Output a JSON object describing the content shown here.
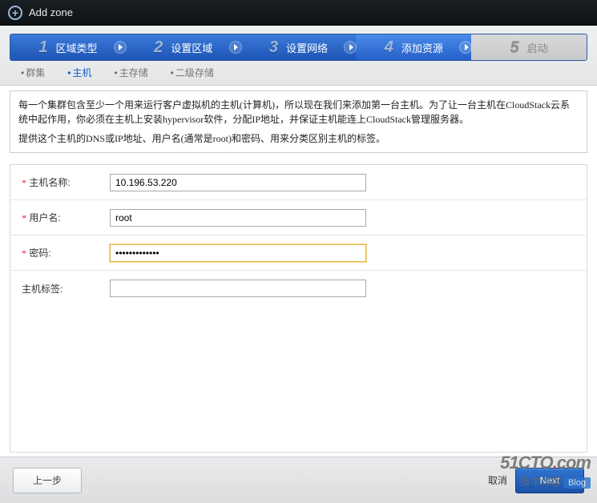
{
  "titlebar": {
    "title": "Add zone"
  },
  "steps": [
    {
      "num": "1",
      "label": "区域类型"
    },
    {
      "num": "2",
      "label": "设置区域"
    },
    {
      "num": "3",
      "label": "设置网络"
    },
    {
      "num": "4",
      "label": "添加资源"
    },
    {
      "num": "5",
      "label": "启动"
    }
  ],
  "subtabs": {
    "cluster": "群集",
    "host": "主机",
    "primary": "主存储",
    "secondary": "二级存储"
  },
  "info": {
    "line1": "每一个集群包含至少一个用来运行客户虚拟机的主机(计算机)，所以现在我们来添加第一台主机。为了让一台主机在CloudStack云系统中起作用，你必须在主机上安装hypervisor软件，分配IP地址，并保证主机能连上CloudStack管理服务器。",
    "line2": "提供这个主机的DNS或IP地址、用户名(通常是root)和密码、用来分类区别主机的标签。"
  },
  "form": {
    "hostname_label": "主机名称:",
    "hostname_value": "10.196.53.220",
    "username_label": "用户名:",
    "username_value": "root",
    "password_label": "密码:",
    "password_value": "•••••••••••••",
    "tags_label": "主机标签:",
    "tags_value": ""
  },
  "buttons": {
    "prev": "上一步",
    "cancel": "取消",
    "next": "Next"
  },
  "watermark": {
    "top_pre": "51CTO",
    "top_dot": ".",
    "top_post": "com",
    "sub": "技术博客",
    "badge": "Blog"
  }
}
